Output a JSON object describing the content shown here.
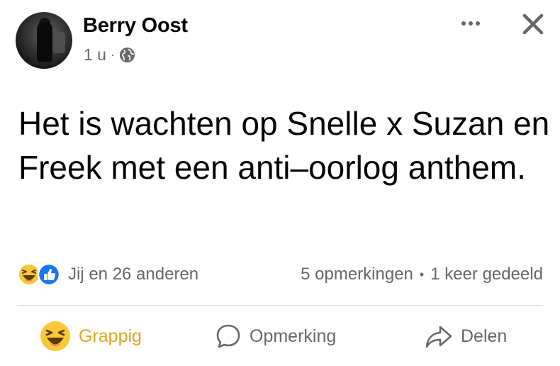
{
  "post": {
    "author": "Berry Oost",
    "time": "1 u",
    "separator": "·",
    "text": "Het is wachten op Snelle x Suzan en Freek met een anti–oorlog anthem."
  },
  "stats": {
    "reactors": "Jij en 26 anderen",
    "comments": "5 opmerkingen",
    "dot": "•",
    "shares": "1 keer gedeeld"
  },
  "actions": {
    "reaction_label": "Grappig",
    "comment_label": "Opmerking",
    "share_label": "Delen"
  },
  "colors": {
    "haha_accent": "#e3a31c",
    "like_blue": "#1877f2",
    "secondary_text": "#65676b"
  },
  "icons": {
    "visibility": "globe-icon",
    "more": "more-options-icon",
    "close": "close-icon",
    "reactions": [
      "haha-reaction-icon",
      "like-reaction-icon"
    ],
    "comment": "comment-icon",
    "share": "share-icon"
  }
}
